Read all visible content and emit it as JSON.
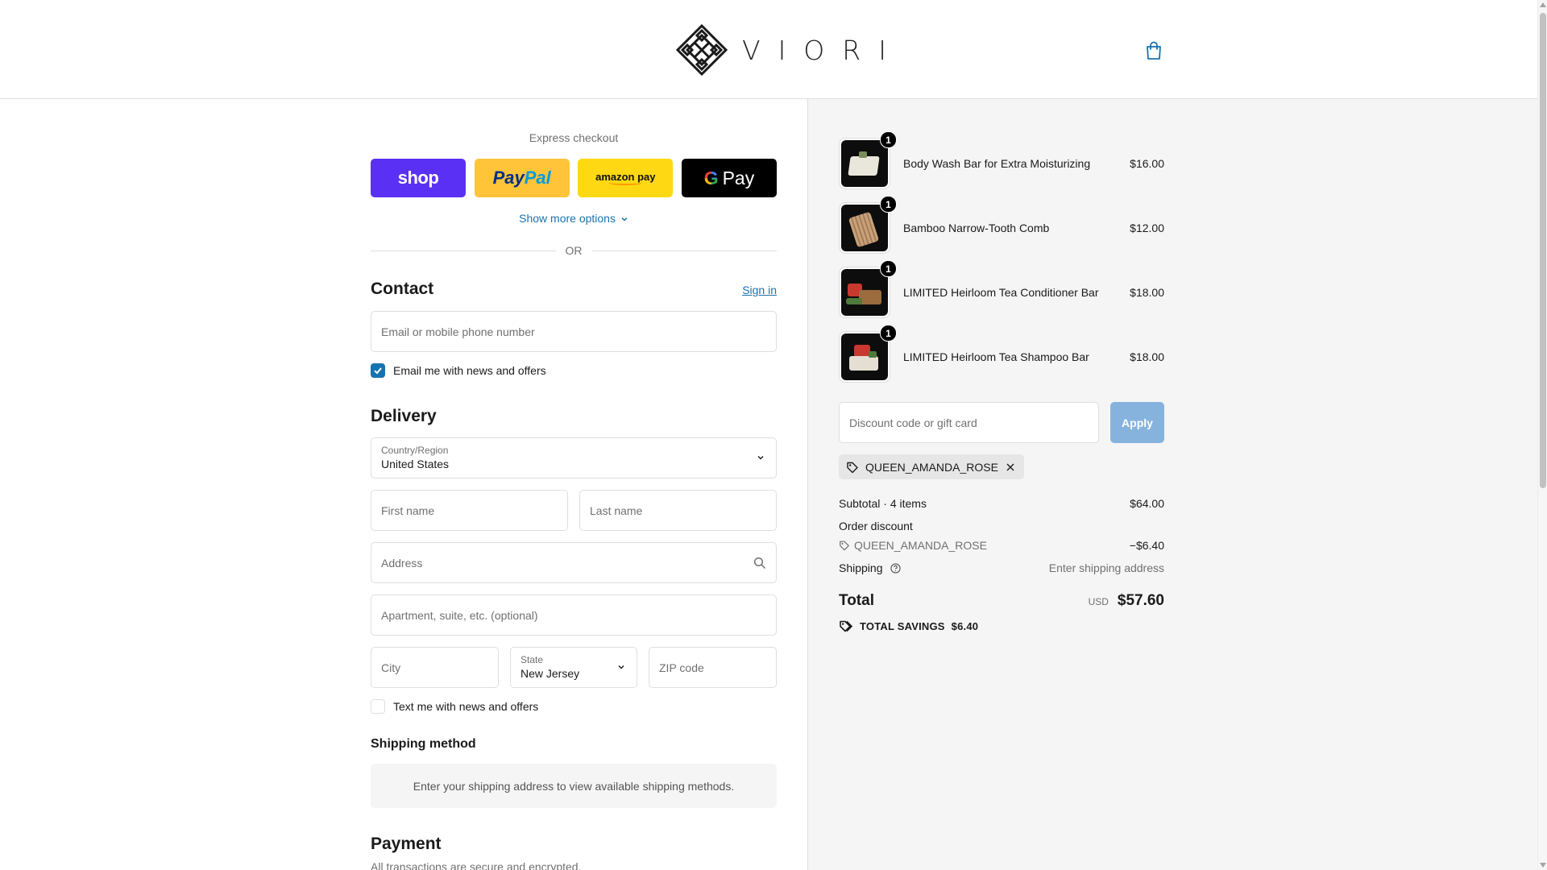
{
  "brand": {
    "name": "VIORI"
  },
  "header": {
    "cart_icon": "shopping-bag-icon"
  },
  "express": {
    "title": "Express checkout",
    "buttons": [
      {
        "label": "shop",
        "color": "#5a31f4"
      },
      {
        "label": "PayPal",
        "color": "#ffc439"
      },
      {
        "label": "amazon pay",
        "color": "#ffd814"
      },
      {
        "label": "Pay",
        "color": "#000000"
      }
    ],
    "show_more": "Show more options",
    "or": "OR"
  },
  "contact": {
    "title": "Contact",
    "sign_in": "Sign in",
    "email_placeholder": "Email or mobile phone number",
    "news_checkbox_label": "Email me with news and offers",
    "news_checked": true
  },
  "delivery": {
    "title": "Delivery",
    "country_label": "Country/Region",
    "country_value": "United States",
    "first_name_placeholder": "First name",
    "last_name_placeholder": "Last name",
    "address_placeholder": "Address",
    "apartment_placeholder": "Apartment, suite, etc. (optional)",
    "city_placeholder": "City",
    "state_label": "State",
    "state_value": "New Jersey",
    "zip_placeholder": "ZIP code",
    "text_checkbox_label": "Text me with news and offers",
    "text_checked": false
  },
  "shipping_method": {
    "title": "Shipping method",
    "message": "Enter your shipping address to view available shipping methods."
  },
  "payment": {
    "title": "Payment",
    "note": "All transactions are secure and encrypted."
  },
  "summary": {
    "items": [
      {
        "name": "Body Wash Bar for Extra Moisturizing",
        "price": "$16.00",
        "qty": "1"
      },
      {
        "name": "Bamboo Narrow-Tooth Comb",
        "price": "$12.00",
        "qty": "1"
      },
      {
        "name": "LIMITED Heirloom Tea Conditioner Bar",
        "price": "$18.00",
        "qty": "1"
      },
      {
        "name": "LIMITED Heirloom Tea Shampoo Bar",
        "price": "$18.00",
        "qty": "1"
      }
    ],
    "discount_placeholder": "Discount code or gift card",
    "apply_label": "Apply",
    "applied_code": "QUEEN_AMANDA_ROSE",
    "subtotal_label": "Subtotal · 4 items",
    "subtotal_value": "$64.00",
    "order_discount_label": "Order discount",
    "discount_code": "QUEEN_AMANDA_ROSE",
    "discount_value": "−$6.40",
    "shipping_label": "Shipping",
    "shipping_value": "Enter shipping address",
    "total_label": "Total",
    "total_currency": "USD",
    "total_value": "$57.60",
    "savings_label": "TOTAL SAVINGS",
    "savings_value": "$6.40"
  },
  "colors": {
    "accent": "#1773b0",
    "apply_button": "#86b3de",
    "summary_background": "#f5f5f5"
  }
}
